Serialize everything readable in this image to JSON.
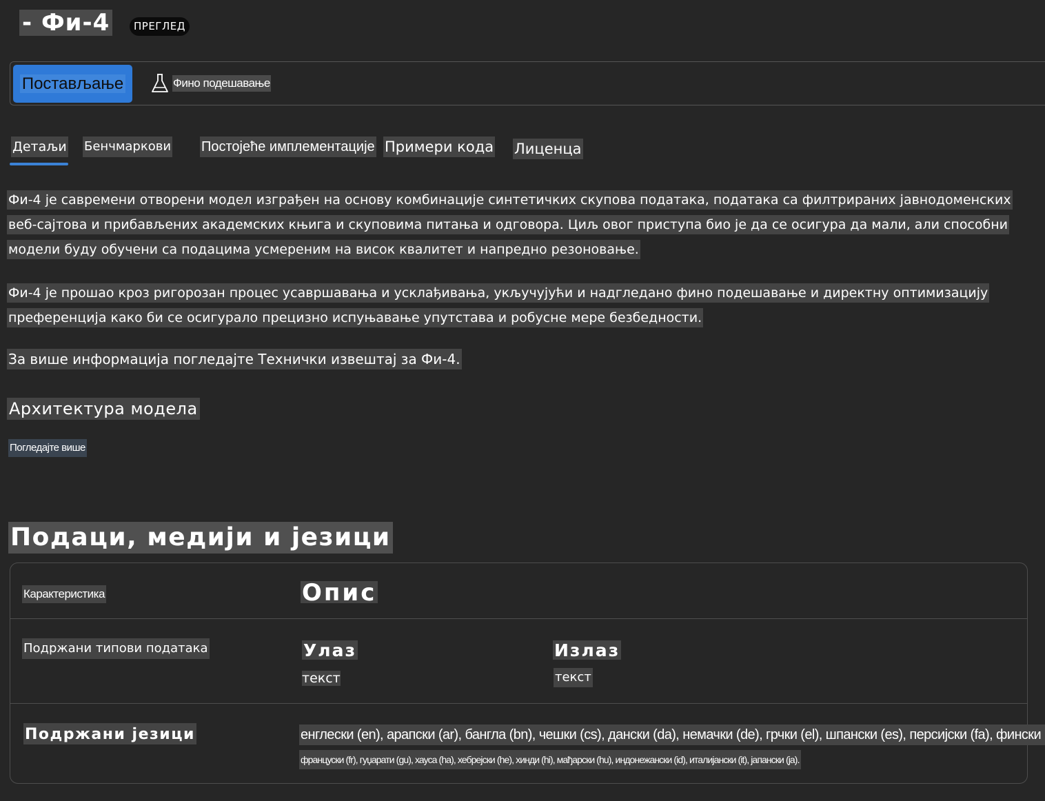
{
  "header": {
    "title": "- Фи-4",
    "badge": "ПРЕГЛЕД"
  },
  "toolbar": {
    "deploy_label": "Постављање",
    "finetune_label": "Фино подешавање",
    "finetune_icon": "flask-icon"
  },
  "tabs": [
    {
      "label": "Детаљи",
      "active": true
    },
    {
      "label": "Бенчмаркови"
    },
    {
      "label": "Постојеће имплементације"
    },
    {
      "label": "Примери кода"
    },
    {
      "label": "Лиценца"
    }
  ],
  "details": {
    "paragraphs": [
      "Фи-4 је савремени отворени модел изграђен на основу комбинације синтетичких скупова података, података са филтрираних јавнодоменских веб-сајтова и прибављених академских књига и скуповима питања и одговора. Циљ овог приступа био је да се осигура да мали, али способни модели буду обучени са подацима усмереним на висок квалитет и напредно резоновање.",
      "Фи-4 је прошао кроз ригорозан процес усавршавања и усклађивања, укључујући и надгледано фино подешавање и директну оптимизацију преференција како би се осигурало прецизно испуњавање упутстава и робусне мере безбедности.",
      "За више информација погледајте Технички извештај за Фи-4."
    ],
    "architecture_title": "Архитектура модела",
    "see_more": "Погледајте више"
  },
  "data_section": {
    "title": "Подаци, медији и језици",
    "table": {
      "header_feature": "Карактеристика",
      "header_description": "Опис",
      "row_types": {
        "label": "Подржани типови података",
        "input_head": "Улаз",
        "input_value": "текст",
        "output_head": "Излаз",
        "output_value": "текст"
      },
      "row_languages": {
        "label": "Подржани језици",
        "line1": "енглески (en), арапски (ar), бангла (bn), чешки (cs), дански (da), немачки (de), грчки (el), шпански (es), персијски (fa), фински (fi),",
        "line2": "француски (fr), гуџарати (gu), хауса (ha), хебрејски (he), хинди (hi), мађарски (hu), индонежански (id), италијански (it), јапански (ja)."
      }
    }
  },
  "colors": {
    "background": "#262626",
    "accent": "#2f7ad8",
    "text_highlight": "#444444"
  }
}
